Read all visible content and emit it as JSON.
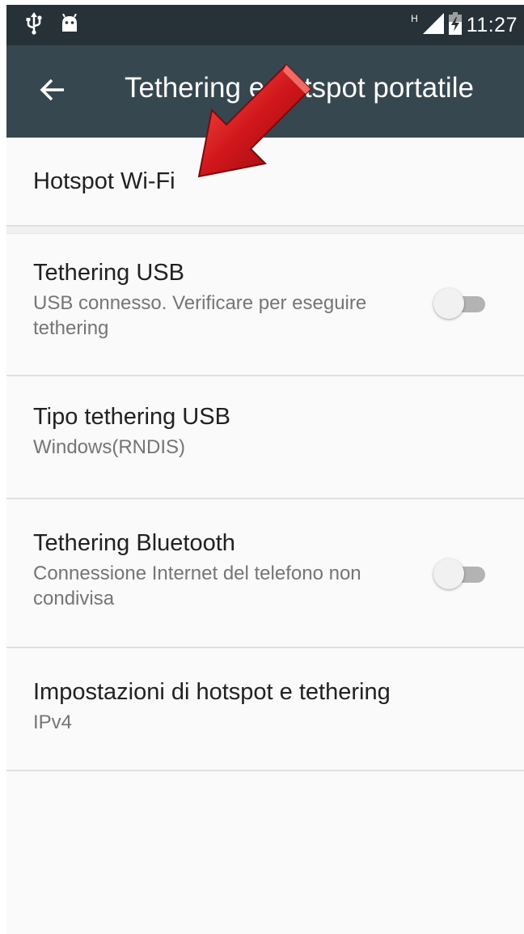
{
  "status_bar": {
    "time": "11:27",
    "network_type": "H",
    "icons": [
      "usb-icon",
      "android-debug-icon",
      "signal-icon",
      "battery-charging-icon"
    ]
  },
  "toolbar": {
    "title": "Tethering e hotspot portatile",
    "back_icon": "arrow-back-icon"
  },
  "list": {
    "wifi_hotspot": {
      "title": "Hotspot Wi-Fi"
    },
    "usb_tethering": {
      "title": "Tethering USB",
      "summary": "USB connesso. Verificare per eseguire tethering",
      "toggle_on": false
    },
    "usb_type": {
      "title": "Tipo tethering USB",
      "summary": "Windows(RNDIS)"
    },
    "bt_tethering": {
      "title": "Tethering Bluetooth",
      "summary": "Connessione Internet del telefono non condivisa",
      "toggle_on": false
    },
    "hotspot_settings": {
      "title": "Impostazioni di hotspot e tethering",
      "summary": "IPv4"
    }
  },
  "colors": {
    "status_bar": "#263238",
    "toolbar": "#37474f",
    "background": "#fafafa",
    "annotation_arrow": "#d0161b"
  }
}
